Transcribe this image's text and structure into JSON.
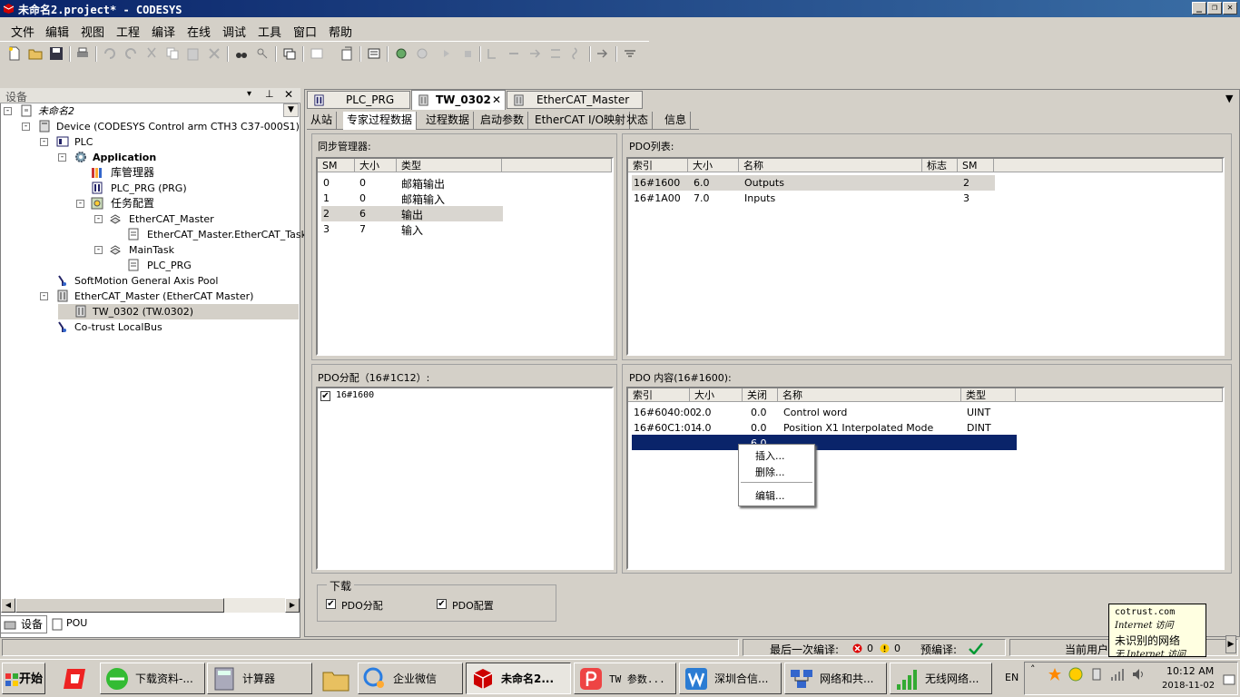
{
  "window": {
    "title": "未命名2.project* - CODESYS"
  },
  "menu": [
    "文件",
    "编辑",
    "视图",
    "工程",
    "编译",
    "在线",
    "调试",
    "工具",
    "窗口",
    "帮助"
  ],
  "device_panel": {
    "title": "设备",
    "tree": [
      {
        "label": "未命名2"
      },
      {
        "label": "Device (CODESYS Control arm CTH3 C37-000S1)"
      },
      {
        "label": "PLC"
      },
      {
        "label": "Application"
      },
      {
        "label": "库管理器"
      },
      {
        "label": "PLC_PRG (PRG)"
      },
      {
        "label": "任务配置"
      },
      {
        "label": "EtherCAT_Master"
      },
      {
        "label": "EtherCAT_Master.EtherCAT_Task"
      },
      {
        "label": "MainTask"
      },
      {
        "label": "PLC_PRG"
      },
      {
        "label": "SoftMotion General Axis Pool"
      },
      {
        "label": "EtherCAT_Master (EtherCAT Master)"
      },
      {
        "label": "TW_0302 (TW.0302)"
      },
      {
        "label": "Co-trust LocalBus"
      }
    ],
    "bottom_tabs": [
      "设备",
      "POU"
    ]
  },
  "editor_tabs": [
    {
      "label": "PLC_PRG"
    },
    {
      "label": "TW_0302"
    },
    {
      "label": "EtherCAT_Master"
    }
  ],
  "sub_tabs": [
    "从站",
    "专家过程数据",
    "过程数据",
    "启动参数",
    "EtherCAT I/O映射",
    "状态",
    "信息"
  ],
  "sync_manager": {
    "title": "同步管理器:",
    "columns": [
      "SM",
      "大小",
      "类型"
    ],
    "rows": [
      [
        "0",
        "0",
        "邮箱输出"
      ],
      [
        "1",
        "0",
        "邮箱输入"
      ],
      [
        "2",
        "6",
        "输出"
      ],
      [
        "3",
        "7",
        "输入"
      ]
    ]
  },
  "pdo_list": {
    "title": "PDO列表:",
    "columns": [
      "索引",
      "大小",
      "名称",
      "标志",
      "SM"
    ],
    "rows": [
      [
        "16#1600",
        "6.0",
        "Outputs",
        "",
        "2"
      ],
      [
        "16#1A00",
        "7.0",
        "Inputs",
        "",
        "3"
      ]
    ]
  },
  "pdo_assign": {
    "title": "PDO分配（16#1C12）:",
    "items": [
      {
        "label": "16#1600",
        "checked": "✔"
      }
    ]
  },
  "pdo_content": {
    "title": "PDO 内容(16#1600):",
    "columns": [
      "索引",
      "大小",
      "关闭",
      "名称",
      "类型"
    ],
    "rows": [
      [
        "16#6040:00",
        "2.0",
        "0.0",
        "Control word",
        "UINT"
      ],
      [
        "16#60C1:01",
        "4.0",
        "0.0",
        "Position X1 Interpolated Mode",
        "DINT"
      ]
    ],
    "partial_value": "6.0"
  },
  "context_menu": [
    "插入...",
    "删除...",
    "编辑..."
  ],
  "download": {
    "title": "下载",
    "options": [
      {
        "label": "PDO分配",
        "checked": "✔"
      },
      {
        "label": "PDO配置",
        "checked": "✔"
      }
    ]
  },
  "status": {
    "last_compile_label": "最后一次编译:",
    "errors": "0",
    "warnings": "0",
    "precompile_label": "预编译:",
    "user_label": "当前用户"
  },
  "tooltip": {
    "line1": "cotrust.com",
    "line2": "Internet 访问",
    "line3": "未识别的网络",
    "line4": "无 Internet 访问"
  },
  "taskbar": {
    "start": "开始",
    "tasks": [
      {
        "label": "下载资料-..."
      },
      {
        "label": "计算器"
      },
      {
        "label": "企业微信"
      },
      {
        "label": "未命名2..."
      },
      {
        "label": "TW 参数..."
      },
      {
        "label": "深圳合信..."
      },
      {
        "label": "网络和共..."
      },
      {
        "label": "无线网络..."
      }
    ],
    "lang": "EN",
    "time": "10:12 AM",
    "date": "2018-11-02"
  },
  "colors": {
    "title_start": "#0a246a",
    "title_end": "#3a6ea5",
    "selection": "#0a246a",
    "row_highlight": "#d9d6d0"
  }
}
